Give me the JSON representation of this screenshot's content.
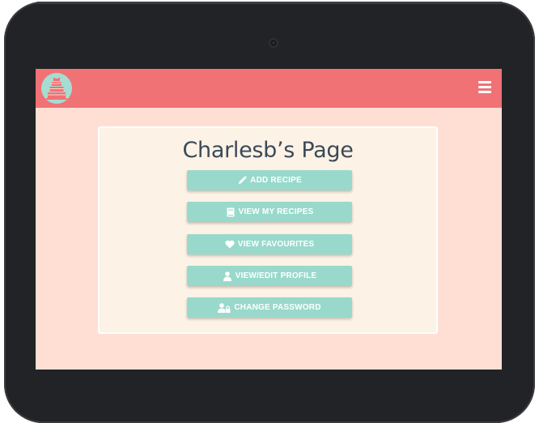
{
  "user_page": {
    "title": "Charlesb’s Page",
    "buttons": [
      {
        "label": "ADD RECIPE",
        "icon": "pencil-icon"
      },
      {
        "label": "VIEW MY RECIPES",
        "icon": "book-icon"
      },
      {
        "label": "VIEW FAVOURITES",
        "icon": "heart-icon"
      },
      {
        "label": "VIEW/EDIT PROFILE",
        "icon": "user-icon"
      },
      {
        "label": "CHANGE PASSWORD",
        "icon": "user-lock-icon"
      }
    ]
  },
  "colors": {
    "navbar": "#f07275",
    "page_background": "#ffdfd4",
    "card_background": "#fdf2e6",
    "button": "#99d9cc",
    "logo_circle": "#a6dcd1"
  },
  "icons": {
    "logo": "cake-logo",
    "menu": "hamburger-menu-icon"
  }
}
